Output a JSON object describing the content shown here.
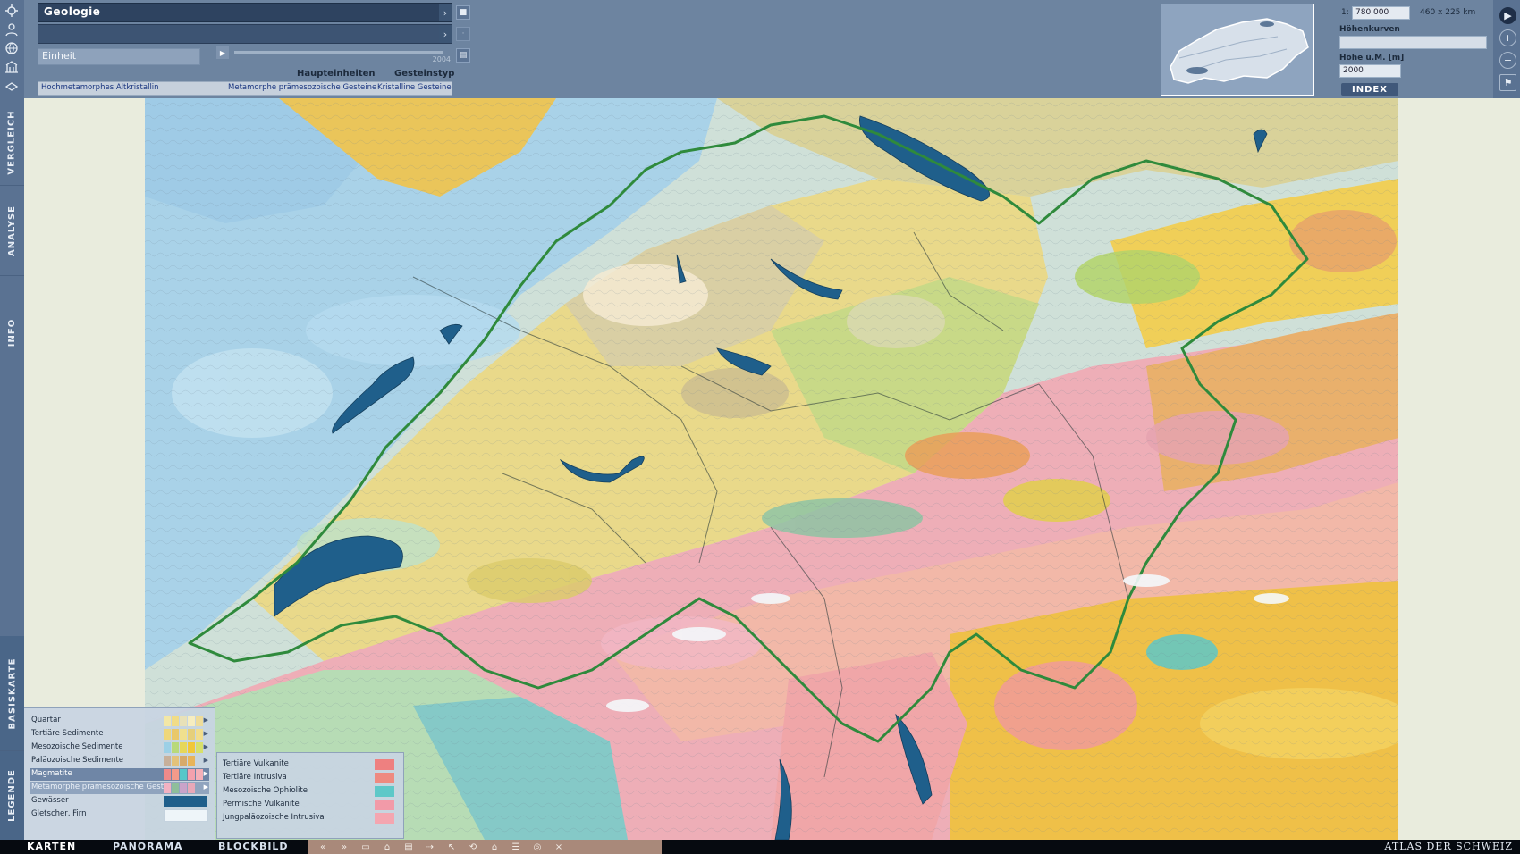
{
  "left_tabs": [
    {
      "label": "VERGLEICH"
    },
    {
      "label": "ANALYSE"
    },
    {
      "label": "INFO"
    },
    {
      "label": "BASISKARTE"
    },
    {
      "label": "LEGENDE"
    }
  ],
  "topic": {
    "title": "Geologie",
    "unit_label": "Einheit",
    "year": "2004",
    "col_haupteinheiten": "Haupteinheiten",
    "col_gesteinstyp": "Gesteinstyp",
    "selection": {
      "unit": "Hochmetamorphes Altkristallin",
      "haupteinheit": "Metamorphe prämesozoische Gesteine",
      "gesteinstyp": "Kristalline Gesteine"
    }
  },
  "scale": {
    "prefix": "1:",
    "value": "780 000",
    "extent": "460 x 225 km",
    "contour_label": "Höhenkurven",
    "height_label": "Höhe ü.M. [m]",
    "height_value": "2000",
    "index_label": "INDEX"
  },
  "legend": {
    "items": [
      {
        "label": "Quartär",
        "colors": [
          "#f3e7a6",
          "#f1dc86",
          "#e8e1b8"
        ]
      },
      {
        "label": "Tertiäre Sedimente",
        "colors": [
          "#efd77a",
          "#e9c86a",
          "#f0e08e"
        ]
      },
      {
        "label": "Mesozoische Sedimente",
        "colors": [
          "#9cd0e6",
          "#b8d97a",
          "#e6d75a",
          "#f1c738"
        ]
      },
      {
        "label": "Paläozoische Sedimente",
        "colors": [
          "#c7b09a",
          "#e3c27a",
          "#d7aa6a"
        ]
      },
      {
        "label": "Magmatite",
        "colors": [
          "#ef8a8a",
          "#56c7c9",
          "#f3a1ad"
        ]
      },
      {
        "label": "Metamorphe prämesozoische Gest.",
        "colors": [
          "#f2b2c2",
          "#8fbe9a",
          "#c9a3c9"
        ]
      },
      {
        "label": "Gewässer",
        "colors": [
          "#1f5f8b"
        ]
      },
      {
        "label": "Gletscher, Firn",
        "colors": [
          "#eef5f9"
        ]
      }
    ],
    "sub_items": [
      {
        "label": "Tertiäre Vulkanite",
        "color": "#ee8080"
      },
      {
        "label": "Tertiäre Intrusiva",
        "color": "#ee8a80"
      },
      {
        "label": "Mesozoische Ophiolite",
        "color": "#5ec8c8"
      },
      {
        "label": "Permische Vulkanite",
        "color": "#f29aa8"
      },
      {
        "label": "Jungpaläozoische Intrusiva",
        "color": "#f4a6b0"
      }
    ]
  },
  "bottom": {
    "tabs": [
      {
        "label": "KARTEN"
      },
      {
        "label": "PANORAMA"
      },
      {
        "label": "BLOCKBILD"
      }
    ],
    "brand": "ATLAS DER SCHWEIZ"
  },
  "colors": {
    "water": "#1f5f8b",
    "border": "#2f8a3c",
    "panel": "#6d84a0"
  }
}
